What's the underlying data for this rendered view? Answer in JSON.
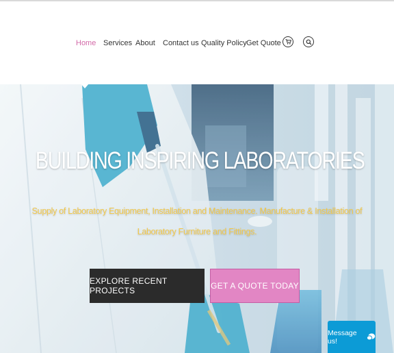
{
  "nav": {
    "items": [
      {
        "label": "Home",
        "active": true
      },
      {
        "label": "Services",
        "active": false
      },
      {
        "label": "About",
        "active": false
      },
      {
        "label": "Contact us",
        "active": false
      },
      {
        "label": "Quality Policy",
        "active": false
      },
      {
        "label": "Get Quote",
        "active": false
      }
    ],
    "icons": [
      "cart-icon",
      "search-icon"
    ]
  },
  "hero": {
    "title": "BUILDING INSPIRING LABORATORIES",
    "subtitle": "Supply of Laboratory Equipment, Installation and Maintenance. Manufacture & Installation of Laboratory Furniture and Fittings.",
    "btn_primary": "EXPLORE RECENT PROJECTS",
    "btn_secondary": "GET A QUOTE TODAY"
  },
  "chat": {
    "label": "Message us!",
    "icon": "chat-bubble-icon"
  },
  "colors": {
    "active_nav": "#d36aa8",
    "subtitle": "#f2c84b",
    "btn_dark": "#2b2b2b",
    "btn_pink": "#e286c4",
    "chat": "#0c9bd6"
  }
}
